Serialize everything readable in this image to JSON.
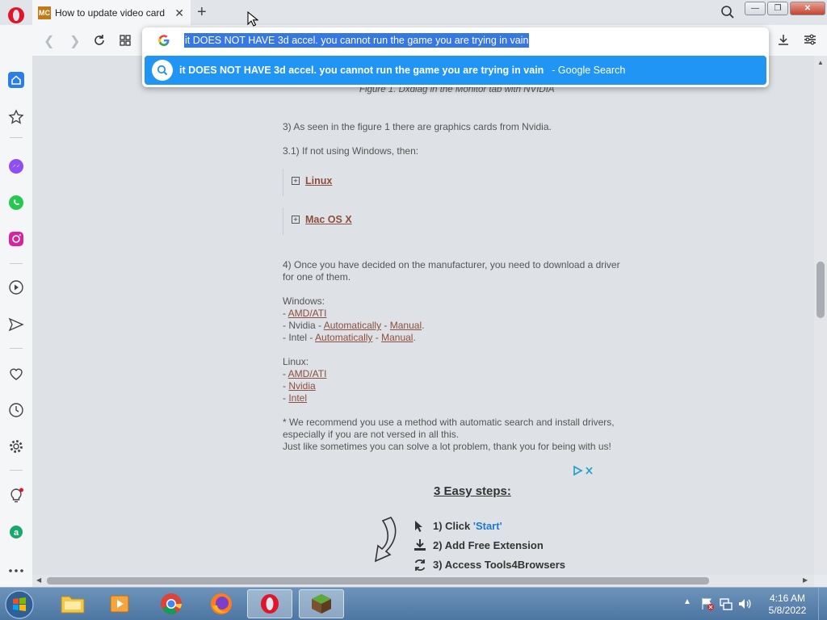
{
  "tab": {
    "favicon_text": "MC",
    "title": "How to update video card",
    "close_glyph": "✕",
    "new_tab_glyph": "+"
  },
  "window": {
    "minimize": "—",
    "maximize": "❐",
    "close": "✕"
  },
  "omnibox": {
    "query": "it DOES NOT HAVE 3d accel. you cannot run the game you are trying in vain",
    "suggestion": "it DOES NOT HAVE 3d accel. you cannot run the game you are trying in vain",
    "suggestion_source": "- Google Search"
  },
  "page": {
    "figure_caption": "Figure 1. Dxdiag in the Monitor tab with NVIDIA",
    "step3": "3) As seen in the figure 1 there are graphics cards from Nvidia.",
    "step31": "3.1) If not using Windows, then:",
    "spoiler_linux": "Linux",
    "spoiler_mac": "Mac OS X",
    "step4_line1": "4) Once you have decided on the manufacturer, you need to download a driver",
    "step4_line2": "for one of them.",
    "windows_label": "Windows:",
    "dash": "- ",
    "amd": "AMD/ATI",
    "nvidia": "Nvidia",
    "intel": "Intel",
    "sep": " - ",
    "automatically": "Automatically",
    "manual": "Manual",
    "dot": ".",
    "linux_label": "Linux:",
    "note1": "* We recommend you use a method with automatic search and install drivers,",
    "note2": "especially if you are not versed in all this.",
    "note3": "Just like sometimes you can solve a lot problem, thank you for being with us!",
    "ad_title": "3 Easy steps:",
    "ad_step1": "1) Click ",
    "ad_step1_quote": "'Start'",
    "ad_step2": "2) Add Free Extension",
    "ad_step3": "3) Access Tools4Browsers"
  },
  "taskbar": {
    "time": "4:16 AM",
    "date": "5/8/2022"
  },
  "colors": {
    "accent": "#2195f3",
    "selection": "#3677e6",
    "link": "#8c4f3f"
  }
}
